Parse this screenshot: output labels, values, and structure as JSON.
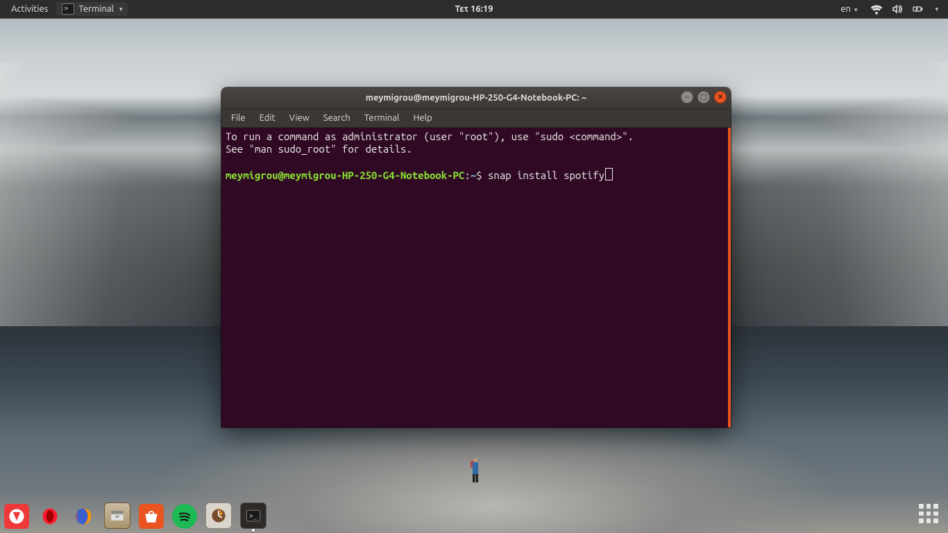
{
  "topbar": {
    "activities": "Activities",
    "app_menu_label": "Terminal",
    "clock": "Τετ 16:19",
    "lang_indicator": "en"
  },
  "window": {
    "title": "meymigrou@meymigrou-HP-250-G4-Notebook-PC: ~",
    "menu": {
      "file": "File",
      "edit": "Edit",
      "view": "View",
      "search": "Search",
      "terminal": "Terminal",
      "help": "Help"
    }
  },
  "terminal": {
    "motd_line1": "To run a command as administrator (user \"root\"), use \"sudo <command>\".",
    "motd_line2": "See \"man sudo_root\" for details.",
    "prompt_userhost": "meymigrou@meymigrou-HP-250-G4-Notebook-PC",
    "prompt_sep": ":",
    "prompt_path": "~",
    "prompt_symbol": "$",
    "typed_command": "snap install spotify"
  },
  "dock": {
    "apps": [
      {
        "name": "vivaldi"
      },
      {
        "name": "opera"
      },
      {
        "name": "firefox"
      },
      {
        "name": "files"
      },
      {
        "name": "ubuntu-software"
      },
      {
        "name": "spotify"
      },
      {
        "name": "software-updater"
      },
      {
        "name": "terminal",
        "running": true
      }
    ]
  }
}
